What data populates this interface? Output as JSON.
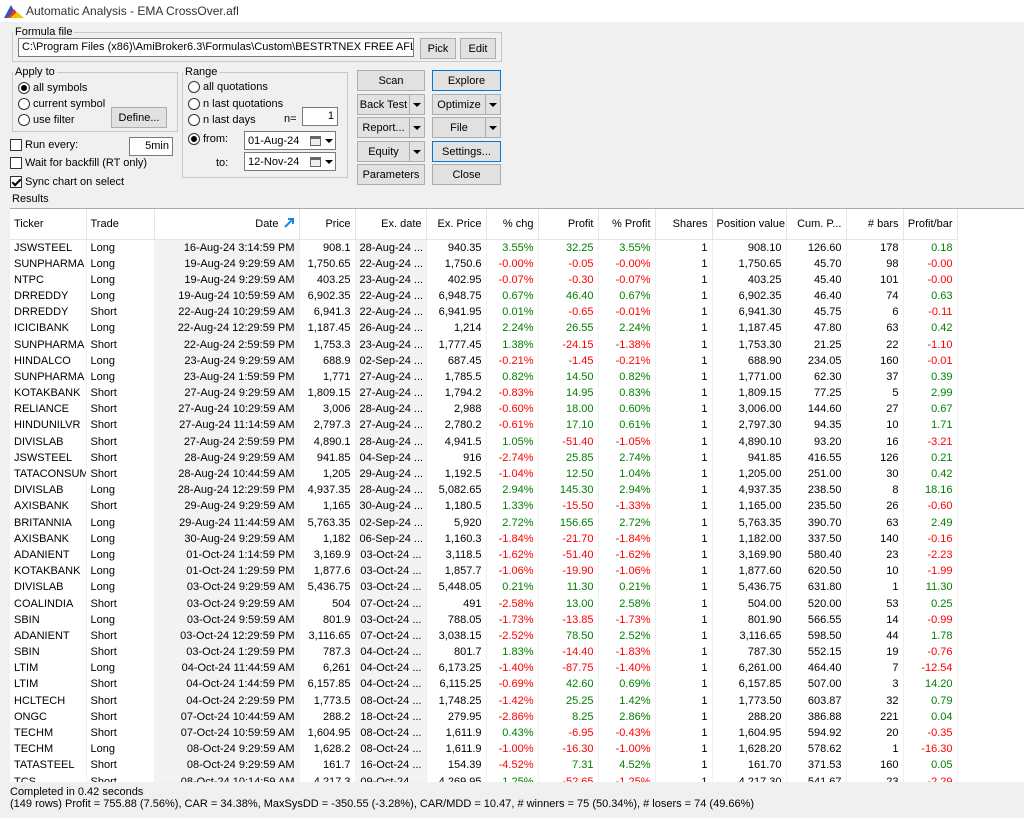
{
  "window": {
    "title": "Automatic Analysis - EMA CrossOver.afl"
  },
  "formula": {
    "group_label": "Formula file",
    "path": "C:\\Program Files (x86)\\AmiBroker6.3\\Formulas\\Custom\\BESTRTNEX  FREE AFL\\EMA C",
    "pick_label": "Pick",
    "edit_label": "Edit"
  },
  "apply_to": {
    "group_label": "Apply to",
    "options": [
      "all symbols",
      "current symbol",
      "use filter"
    ],
    "selected": "all symbols",
    "define_label": "Define..."
  },
  "range": {
    "group_label": "Range",
    "all_quotations": "all quotations",
    "n_last_quotations": "n last quotations",
    "n_last_days": "n last days",
    "n_label": "n=",
    "n_value": "1",
    "from_label": "from:",
    "from_value": "01-Aug-24",
    "to_label": "to:",
    "to_value": "12-Nov-24",
    "selected": "from"
  },
  "options": {
    "run_every_label": "Run every:",
    "run_every_value": "5min",
    "run_every_checked": false,
    "wait_backfill_label": "Wait for backfill (RT only)",
    "wait_backfill_checked": false,
    "sync_chart_label": "Sync chart on select",
    "sync_chart_checked": true
  },
  "actions": {
    "scan": "Scan",
    "explore": "Explore",
    "back_test": "Back Test",
    "optimize": "Optimize",
    "report": "Report...",
    "file": "File",
    "equity": "Equity",
    "settings": "Settings...",
    "parameters": "Parameters",
    "close": "Close"
  },
  "results": {
    "label": "Results",
    "columns": [
      "Ticker",
      "Trade",
      "Date",
      "Price",
      "Ex. date",
      "Ex. Price",
      "% chg",
      "Profit",
      "% Profit",
      "Shares",
      "Position value",
      "Cum. P...",
      "# bars",
      "Profit/bar"
    ],
    "rows": [
      [
        "JSWSTEEL",
        "Long",
        "16-Aug-24 3:14:59 PM",
        "908.1",
        "28-Aug-24 ...",
        "940.35",
        "3.55%",
        "32.25",
        "3.55%",
        "1",
        "908.10",
        "126.60",
        "178",
        "0.18"
      ],
      [
        "SUNPHARMA",
        "Long",
        "19-Aug-24 9:29:59 AM",
        "1,750.65",
        "22-Aug-24 ...",
        "1,750.6",
        "-0.00%",
        "-0.05",
        "-0.00%",
        "1",
        "1,750.65",
        "45.70",
        "98",
        "-0.00"
      ],
      [
        "NTPC",
        "Long",
        "19-Aug-24 9:29:59 AM",
        "403.25",
        "23-Aug-24 ...",
        "402.95",
        "-0.07%",
        "-0.30",
        "-0.07%",
        "1",
        "403.25",
        "45.40",
        "101",
        "-0.00"
      ],
      [
        "DRREDDY",
        "Long",
        "19-Aug-24 10:59:59 AM",
        "6,902.35",
        "22-Aug-24 ...",
        "6,948.75",
        "0.67%",
        "46.40",
        "0.67%",
        "1",
        "6,902.35",
        "46.40",
        "74",
        "0.63"
      ],
      [
        "DRREDDY",
        "Short",
        "22-Aug-24 10:29:59 AM",
        "6,941.3",
        "22-Aug-24 ...",
        "6,941.95",
        "0.01%",
        "-0.65",
        "-0.01%",
        "1",
        "6,941.30",
        "45.75",
        "6",
        "-0.11"
      ],
      [
        "ICICIBANK",
        "Long",
        "22-Aug-24 12:29:59 PM",
        "1,187.45",
        "26-Aug-24 ...",
        "1,214",
        "2.24%",
        "26.55",
        "2.24%",
        "1",
        "1,187.45",
        "47.80",
        "63",
        "0.42"
      ],
      [
        "SUNPHARMA",
        "Short",
        "22-Aug-24 2:59:59 PM",
        "1,753.3",
        "23-Aug-24 ...",
        "1,777.45",
        "1.38%",
        "-24.15",
        "-1.38%",
        "1",
        "1,753.30",
        "21.25",
        "22",
        "-1.10"
      ],
      [
        "HINDALCO",
        "Long",
        "23-Aug-24 9:29:59 AM",
        "688.9",
        "02-Sep-24 ...",
        "687.45",
        "-0.21%",
        "-1.45",
        "-0.21%",
        "1",
        "688.90",
        "234.05",
        "160",
        "-0.01"
      ],
      [
        "SUNPHARMA",
        "Long",
        "23-Aug-24 1:59:59 PM",
        "1,771",
        "27-Aug-24 ...",
        "1,785.5",
        "0.82%",
        "14.50",
        "0.82%",
        "1",
        "1,771.00",
        "62.30",
        "37",
        "0.39"
      ],
      [
        "KOTAKBANK",
        "Short",
        "27-Aug-24 9:29:59 AM",
        "1,809.15",
        "27-Aug-24 ...",
        "1,794.2",
        "-0.83%",
        "14.95",
        "0.83%",
        "1",
        "1,809.15",
        "77.25",
        "5",
        "2.99"
      ],
      [
        "RELIANCE",
        "Short",
        "27-Aug-24 10:29:59 AM",
        "3,006",
        "28-Aug-24 ...",
        "2,988",
        "-0.60%",
        "18.00",
        "0.60%",
        "1",
        "3,006.00",
        "144.60",
        "27",
        "0.67"
      ],
      [
        "HINDUNILVR",
        "Short",
        "27-Aug-24 11:14:59 AM",
        "2,797.3",
        "27-Aug-24 ...",
        "2,780.2",
        "-0.61%",
        "17.10",
        "0.61%",
        "1",
        "2,797.30",
        "94.35",
        "10",
        "1.71"
      ],
      [
        "DIVISLAB",
        "Short",
        "27-Aug-24 2:59:59 PM",
        "4,890.1",
        "28-Aug-24 ...",
        "4,941.5",
        "1.05%",
        "-51.40",
        "-1.05%",
        "1",
        "4,890.10",
        "93.20",
        "16",
        "-3.21"
      ],
      [
        "JSWSTEEL",
        "Short",
        "28-Aug-24 9:29:59 AM",
        "941.85",
        "04-Sep-24 ...",
        "916",
        "-2.74%",
        "25.85",
        "2.74%",
        "1",
        "941.85",
        "416.55",
        "126",
        "0.21"
      ],
      [
        "TATACONSUM",
        "Short",
        "28-Aug-24 10:44:59 AM",
        "1,205",
        "29-Aug-24 ...",
        "1,192.5",
        "-1.04%",
        "12.50",
        "1.04%",
        "1",
        "1,205.00",
        "251.00",
        "30",
        "0.42"
      ],
      [
        "DIVISLAB",
        "Long",
        "28-Aug-24 12:29:59 PM",
        "4,937.35",
        "28-Aug-24 ...",
        "5,082.65",
        "2.94%",
        "145.30",
        "2.94%",
        "1",
        "4,937.35",
        "238.50",
        "8",
        "18.16"
      ],
      [
        "AXISBANK",
        "Short",
        "29-Aug-24 9:29:59 AM",
        "1,165",
        "30-Aug-24 ...",
        "1,180.5",
        "1.33%",
        "-15.50",
        "-1.33%",
        "1",
        "1,165.00",
        "235.50",
        "26",
        "-0.60"
      ],
      [
        "BRITANNIA",
        "Long",
        "29-Aug-24 11:44:59 AM",
        "5,763.35",
        "02-Sep-24 ...",
        "5,920",
        "2.72%",
        "156.65",
        "2.72%",
        "1",
        "5,763.35",
        "390.70",
        "63",
        "2.49"
      ],
      [
        "AXISBANK",
        "Long",
        "30-Aug-24 9:29:59 AM",
        "1,182",
        "06-Sep-24 ...",
        "1,160.3",
        "-1.84%",
        "-21.70",
        "-1.84%",
        "1",
        "1,182.00",
        "337.50",
        "140",
        "-0.16"
      ],
      [
        "ADANIENT",
        "Long",
        "01-Oct-24 1:14:59 PM",
        "3,169.9",
        "03-Oct-24 ...",
        "3,118.5",
        "-1.62%",
        "-51.40",
        "-1.62%",
        "1",
        "3,169.90",
        "580.40",
        "23",
        "-2.23"
      ],
      [
        "KOTAKBANK",
        "Long",
        "01-Oct-24 1:29:59 PM",
        "1,877.6",
        "03-Oct-24 ...",
        "1,857.7",
        "-1.06%",
        "-19.90",
        "-1.06%",
        "1",
        "1,877.60",
        "620.50",
        "10",
        "-1.99"
      ],
      [
        "DIVISLAB",
        "Long",
        "03-Oct-24 9:29:59 AM",
        "5,436.75",
        "03-Oct-24 ...",
        "5,448.05",
        "0.21%",
        "11.30",
        "0.21%",
        "1",
        "5,436.75",
        "631.80",
        "1",
        "11.30"
      ],
      [
        "COALINDIA",
        "Short",
        "03-Oct-24 9:29:59 AM",
        "504",
        "07-Oct-24 ...",
        "491",
        "-2.58%",
        "13.00",
        "2.58%",
        "1",
        "504.00",
        "520.00",
        "53",
        "0.25"
      ],
      [
        "SBIN",
        "Long",
        "03-Oct-24 9:59:59 AM",
        "801.9",
        "03-Oct-24 ...",
        "788.05",
        "-1.73%",
        "-13.85",
        "-1.73%",
        "1",
        "801.90",
        "566.55",
        "14",
        "-0.99"
      ],
      [
        "ADANIENT",
        "Short",
        "03-Oct-24 12:29:59 PM",
        "3,116.65",
        "07-Oct-24 ...",
        "3,038.15",
        "-2.52%",
        "78.50",
        "2.52%",
        "1",
        "3,116.65",
        "598.50",
        "44",
        "1.78"
      ],
      [
        "SBIN",
        "Short",
        "03-Oct-24 1:29:59 PM",
        "787.3",
        "04-Oct-24 ...",
        "801.7",
        "1.83%",
        "-14.40",
        "-1.83%",
        "1",
        "787.30",
        "552.15",
        "19",
        "-0.76"
      ],
      [
        "LTIM",
        "Long",
        "04-Oct-24 11:44:59 AM",
        "6,261",
        "04-Oct-24 ...",
        "6,173.25",
        "-1.40%",
        "-87.75",
        "-1.40%",
        "1",
        "6,261.00",
        "464.40",
        "7",
        "-12.54"
      ],
      [
        "LTIM",
        "Short",
        "04-Oct-24 1:44:59 PM",
        "6,157.85",
        "04-Oct-24 ...",
        "6,115.25",
        "-0.69%",
        "42.60",
        "0.69%",
        "1",
        "6,157.85",
        "507.00",
        "3",
        "14.20"
      ],
      [
        "HCLTECH",
        "Short",
        "04-Oct-24 2:29:59 PM",
        "1,773.5",
        "08-Oct-24 ...",
        "1,748.25",
        "-1.42%",
        "25.25",
        "1.42%",
        "1",
        "1,773.50",
        "603.87",
        "32",
        "0.79"
      ],
      [
        "ONGC",
        "Short",
        "07-Oct-24 10:44:59 AM",
        "288.2",
        "18-Oct-24 ...",
        "279.95",
        "-2.86%",
        "8.25",
        "2.86%",
        "1",
        "288.20",
        "386.88",
        "221",
        "0.04"
      ],
      [
        "TECHM",
        "Short",
        "07-Oct-24 10:59:59 AM",
        "1,604.95",
        "08-Oct-24 ...",
        "1,611.9",
        "0.43%",
        "-6.95",
        "-0.43%",
        "1",
        "1,604.95",
        "594.92",
        "20",
        "-0.35"
      ],
      [
        "TECHM",
        "Long",
        "08-Oct-24 9:29:59 AM",
        "1,628.2",
        "08-Oct-24 ...",
        "1,611.9",
        "-1.00%",
        "-16.30",
        "-1.00%",
        "1",
        "1,628.20",
        "578.62",
        "1",
        "-16.30"
      ],
      [
        "TATASTEEL",
        "Short",
        "08-Oct-24 9:29:59 AM",
        "161.7",
        "16-Oct-24 ...",
        "154.39",
        "-4.52%",
        "7.31",
        "4.52%",
        "1",
        "161.70",
        "371.53",
        "160",
        "0.05"
      ],
      [
        "TCS",
        "Short",
        "08-Oct-24 10:14:59 AM",
        "4,217.3",
        "09-Oct-24 ...",
        "4,269.95",
        "1.25%",
        "-52.65",
        "-1.25%",
        "1",
        "4,217.30",
        "541.67",
        "23",
        "-2.29"
      ]
    ]
  },
  "status": {
    "line1": "Completed in 0.42 seconds",
    "line2": "(149 rows) Profit = 755.88 (7.56%), CAR = 34.38%, MaxSysDD = -350.55 (-3.28%), CAR/MDD = 10.47, # winners = 75 (50.34%), # losers = 74 (49.66%)"
  },
  "colors": {
    "positive": "#008000",
    "negative": "#ff0000",
    "accent": "#0078d7"
  }
}
